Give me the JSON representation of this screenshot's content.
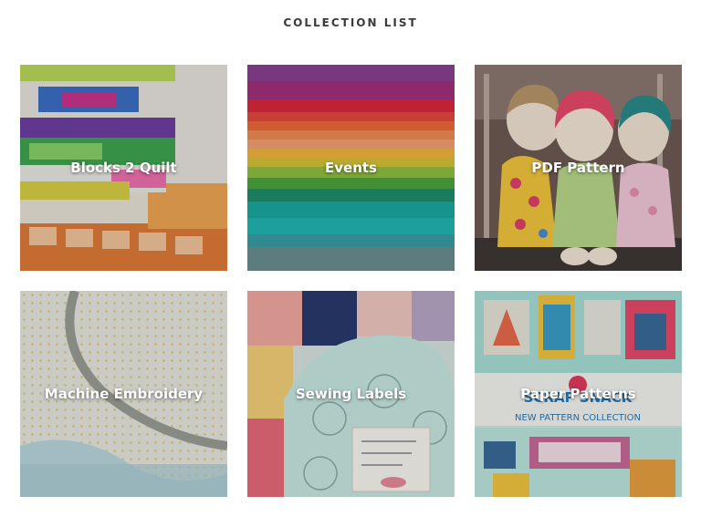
{
  "page": {
    "title": "COLLECTION LIST"
  },
  "collections": [
    {
      "label": "Blocks 2 Quilt",
      "image": "quilt-blocks-stack-photo"
    },
    {
      "label": "Events",
      "image": "rainbow-fabric-stack-photo"
    },
    {
      "label": "PDF Pattern",
      "image": "fabric-dolls-photo"
    },
    {
      "label": "Machine Embroidery",
      "image": "polka-dot-fabric-photo"
    },
    {
      "label": "Sewing Labels",
      "image": "quilt-with-label-photo"
    },
    {
      "label": "Paper Patterns",
      "image": "scrap-snack-pattern-cover-photo"
    }
  ],
  "image_text": {
    "paper_patterns_cover_title": "SCRAP SNACK",
    "paper_patterns_cover_subtitle": "NEW PATTERN COLLECTION"
  },
  "colors": {
    "title": "#3a3a3a",
    "label": "#ffffff"
  }
}
